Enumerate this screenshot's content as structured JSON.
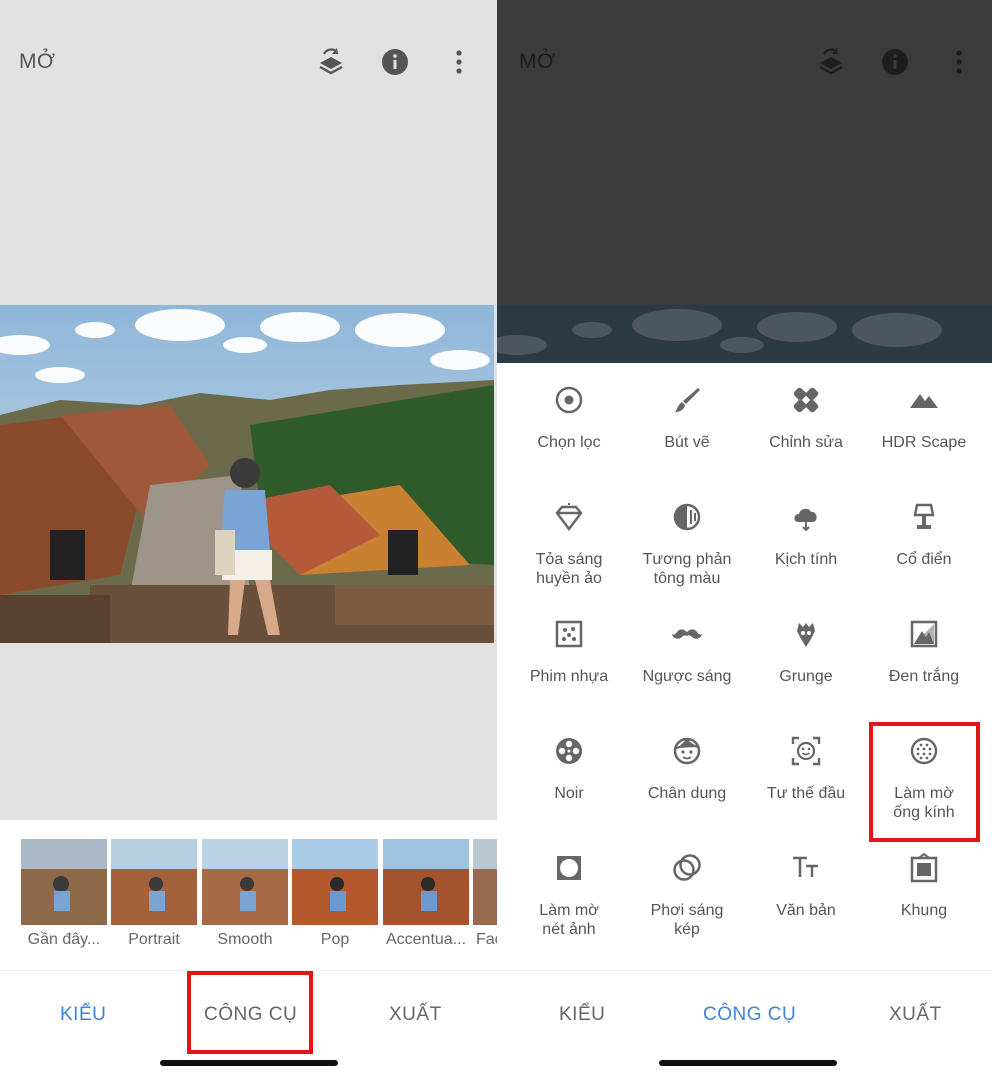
{
  "left": {
    "header": {
      "open_label": "MỞ"
    },
    "styles": [
      {
        "label": "Gần đây..."
      },
      {
        "label": "Portrait"
      },
      {
        "label": "Smooth"
      },
      {
        "label": "Pop"
      },
      {
        "label": "Accentua..."
      },
      {
        "label": "Fac"
      }
    ],
    "nav": {
      "styles": "KIỂU",
      "tools": "CÔNG CỤ",
      "export": "XUẤT",
      "active": "tools"
    }
  },
  "right": {
    "header": {
      "open_label": "MỞ"
    },
    "tools": [
      {
        "label": "Chọn lọc",
        "icon": "selective-icon"
      },
      {
        "label": "Bút vẽ",
        "icon": "brush-icon"
      },
      {
        "label": "Chỉnh sửa",
        "icon": "healing-icon"
      },
      {
        "label": "HDR Scape",
        "icon": "mountain-icon"
      },
      {
        "label": "Tỏa sáng\nhuyền ảo",
        "icon": "diamond-icon"
      },
      {
        "label": "Tương phản\ntông màu",
        "icon": "tonal-contrast-icon"
      },
      {
        "label": "Kịch tính",
        "icon": "drama-cloud-icon"
      },
      {
        "label": "Cổ điển",
        "icon": "lamp-icon"
      },
      {
        "label": "Phim nhựa",
        "icon": "grainy-film-icon"
      },
      {
        "label": "Ngược sáng",
        "icon": "mustache-icon"
      },
      {
        "label": "Grunge",
        "icon": "grunge-icon"
      },
      {
        "label": "Đen trắng",
        "icon": "black-white-icon"
      },
      {
        "label": "Noir",
        "icon": "film-reel-icon"
      },
      {
        "label": "Chân dung",
        "icon": "face-icon"
      },
      {
        "label": "Tư thế đầu",
        "icon": "head-pose-icon"
      },
      {
        "label": "Làm mờ\nống kính",
        "icon": "lens-blur-icon"
      },
      {
        "label": "Làm mờ\nnét ảnh",
        "icon": "vignette-icon"
      },
      {
        "label": "Phơi sáng\nkép",
        "icon": "double-exposure-icon"
      },
      {
        "label": "Văn bản",
        "icon": "text-icon"
      },
      {
        "label": "Khung",
        "icon": "frame-icon"
      }
    ],
    "nav": {
      "styles": "KIỂU",
      "tools": "CÔNG CỤ",
      "export": "XUẤT",
      "active": "tools"
    }
  },
  "colors": {
    "accent": "#3d83d8",
    "highlight": "#e3141a"
  }
}
